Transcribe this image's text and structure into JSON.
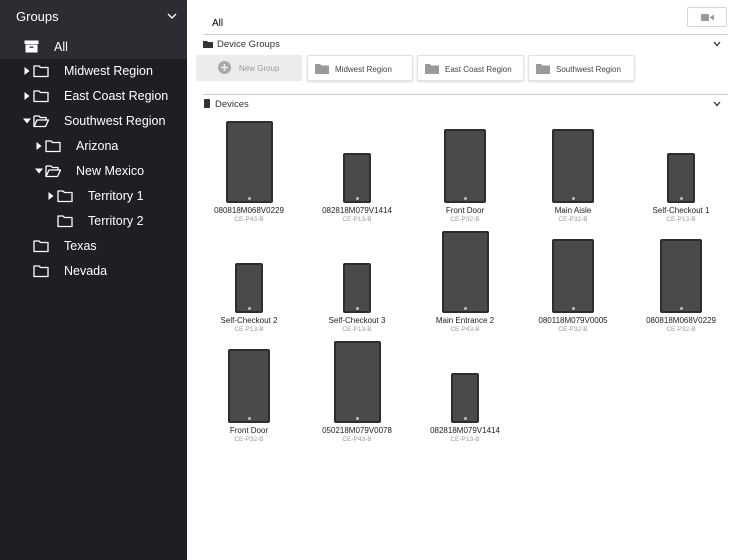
{
  "sidebar": {
    "header_title": "Groups",
    "all_label": "All",
    "tree": [
      {
        "label": "Midwest Region",
        "expanded": false,
        "has_children": true
      },
      {
        "label": "East Coast Region",
        "expanded": false,
        "has_children": true
      },
      {
        "label": "Southwest Region",
        "expanded": true,
        "has_children": true
      },
      {
        "label": "Arizona",
        "expanded": false,
        "has_children": true
      },
      {
        "label": "New Mexico",
        "expanded": true,
        "has_children": true
      },
      {
        "label": "Territory 1",
        "expanded": false,
        "has_children": true
      },
      {
        "label": "Territory 2",
        "expanded": false,
        "has_children": false
      },
      {
        "label": "Texas",
        "expanded": false,
        "has_children": false
      },
      {
        "label": "Nevada",
        "expanded": false,
        "has_children": false
      }
    ],
    "icons": {
      "all": "archive-box-icon",
      "folder": "folder-icon",
      "folder_open": "folder-open-icon",
      "caret_right": "caret-right-icon",
      "caret_down": "caret-down-icon"
    }
  },
  "main": {
    "tab_label": "All",
    "camera_icon": "video-camera-icon",
    "device_groups": {
      "title": "Device Groups",
      "new_group_label": "New Group",
      "groups": [
        "Midwest Region",
        "East Coast Region",
        "Southwest Region"
      ]
    },
    "devices_section": {
      "title": "Devices",
      "items": [
        {
          "name": "080818M068V0229",
          "model": "CE-P43-B"
        },
        {
          "name": "082818M079V1414",
          "model": "CE-P13-B"
        },
        {
          "name": "Front Door",
          "model": "CE-P32-B"
        },
        {
          "name": "Main Aisle",
          "model": "CE-P32-B"
        },
        {
          "name": "Self-Checkout 1",
          "model": "CE-P13-B"
        },
        {
          "name": "Self-Checkout 2",
          "model": "CE-P13-B"
        },
        {
          "name": "Self-Checkout 3",
          "model": "CE-P13-B"
        },
        {
          "name": "Main Entrance 2",
          "model": "CE-P43-B"
        },
        {
          "name": "080118M079V0005",
          "model": "CE-P32-B"
        },
        {
          "name": "080818M068V0229",
          "model": "CE-P32-B"
        },
        {
          "name": "Front Door",
          "model": "CE-P32-B"
        },
        {
          "name": "050218M079V0078",
          "model": "CE-P43-B"
        },
        {
          "name": "082818M079V1414",
          "model": "CE-P13-B"
        }
      ]
    }
  },
  "colors": {
    "sidebar_bg": "#1e1f22",
    "sidebar_header_bg": "#2b2d30",
    "device_screen": "#4a4a4a",
    "device_frame": "#2d2d2d"
  }
}
